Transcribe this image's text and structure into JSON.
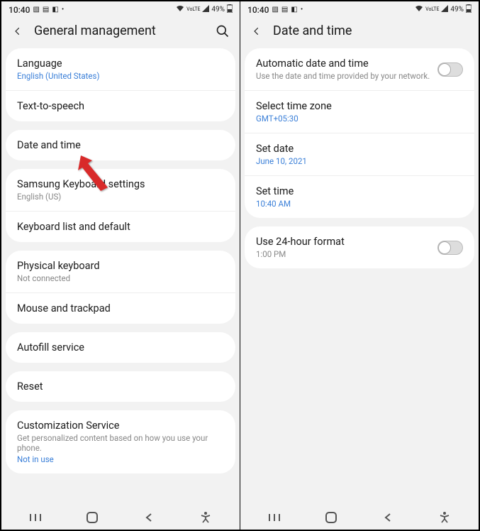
{
  "status": {
    "time": "10:40",
    "battery_pct": "49%"
  },
  "left_screen": {
    "title": "General management",
    "group1": [
      {
        "title": "Language",
        "sub": "English (United States)",
        "link": true
      },
      {
        "title": "Text-to-speech"
      }
    ],
    "group2": [
      {
        "title": "Date and time"
      }
    ],
    "group3": [
      {
        "title": "Samsung Keyboard settings",
        "sub": "English (US)"
      },
      {
        "title": "Keyboard list and default"
      }
    ],
    "group4": [
      {
        "title": "Physical keyboard",
        "sub": "Not connected"
      },
      {
        "title": "Mouse and trackpad"
      }
    ],
    "group5": [
      {
        "title": "Autofill service"
      }
    ],
    "group6": [
      {
        "title": "Reset"
      }
    ],
    "group7": [
      {
        "title": "Customization Service",
        "sub": "Get personalized content based on how you use your phone.",
        "sub2": "Not in use"
      }
    ]
  },
  "right_screen": {
    "title": "Date and time",
    "group1": [
      {
        "title": "Automatic date and time",
        "sub": "Use the date and time provided by your network.",
        "toggle": true
      },
      {
        "title": "Select time zone",
        "sub": "GMT+05:30",
        "link": true
      },
      {
        "title": "Set date",
        "sub": "June 10, 2021",
        "link": true
      },
      {
        "title": "Set time",
        "sub": "10:40 AM",
        "link": true
      }
    ],
    "group2": [
      {
        "title": "Use 24-hour format",
        "sub": "1:00 PM",
        "toggle": true
      }
    ]
  }
}
